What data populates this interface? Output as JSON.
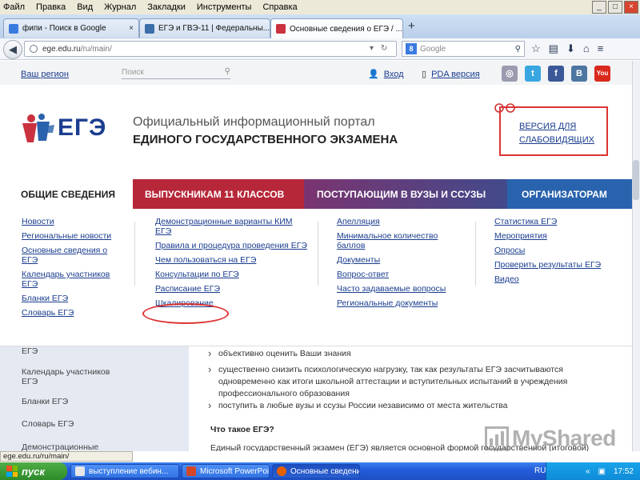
{
  "browser": {
    "menu": [
      "Файл",
      "Правка",
      "Вид",
      "Журнал",
      "Закладки",
      "Инструменты",
      "Справка"
    ],
    "tabs": [
      {
        "label": "фипи - Поиск в Google"
      },
      {
        "label": "ЕГЭ и ГВЭ-11 | Федеральны..."
      },
      {
        "label": "Основные сведения о ЕГЭ / ..."
      }
    ],
    "url_host": "ege.edu.ru",
    "url_path": "/ru/main/",
    "search_placeholder": "Google",
    "status_url": "ege.edu.ru/ru/main/"
  },
  "top": {
    "region": "Ваш регион",
    "search_placeholder": "Поиск",
    "login": "Вход",
    "pda": "PDA версия",
    "social": [
      "ok",
      "twitter",
      "f",
      "B",
      "You"
    ]
  },
  "header": {
    "logo": "ЕГЭ",
    "title_line1": "Официальный информационный портал",
    "title_line2": "ЕДИНОГО ГОСУДАРСТВЕННОГО ЭКЗАМЕНА",
    "vision_line1": "ВЕРСИЯ ДЛЯ",
    "vision_line2": "СЛАБОВИДЯЩИХ"
  },
  "nav": {
    "general": "ОБЩИЕ СВЕДЕНИЯ",
    "graduates": "ВЫПУСКНИКАМ 11 КЛАССОВ",
    "applicants": "ПОСТУПАЮЩИМ В ВУЗЫ И ССУЗЫ",
    "organizers": "ОРГАНИЗАТОРАМ"
  },
  "dropdown": {
    "col1": [
      "Новости",
      "Региональные новости",
      "Основные сведения о ЕГЭ",
      "Календарь участников ЕГЭ",
      "Бланки ЕГЭ",
      "Словарь ЕГЭ"
    ],
    "col2": [
      "Демонстрационные варианты КИМ ЕГЭ",
      "Правила и процедура проведения ЕГЭ",
      "Чем пользоваться на ЕГЭ",
      "Консультации по ЕГЭ",
      "Расписание ЕГЭ",
      "Шкалирование"
    ],
    "col3": [
      "Апелляция",
      "Минимальное количество баллов",
      "Документы",
      "Вопрос-ответ",
      "Часто задаваемые вопросы",
      "Региональные документы"
    ],
    "col4": [
      "Статистика ЕГЭ",
      "Мероприятия",
      "Опросы",
      "Проверить результаты ЕГЭ",
      "Видео"
    ]
  },
  "sidebar": {
    "items": [
      "ЕГЭ",
      "Календарь участников ЕГЭ",
      "Бланки ЕГЭ",
      "Словарь ЕГЭ",
      "Демонстрационные"
    ]
  },
  "content": {
    "bullets": [
      "объективно оценить Ваши знания",
      "существенно снизить психологическую нагрузку, так как результаты ЕГЭ засчитываются одновременно как итоги школьной аттестации и вступительных испытаний в учреждения профессионального образования",
      "поступить в любые вузы и ссузы России независимо от места жительства"
    ],
    "question": "Что такое ЕГЭ?",
    "paragraph": "Единый государственный экзамен (ЕГЭ) является основной формой государственной (итоговой)"
  },
  "watermark": "MyShared",
  "taskbar": {
    "start": "пуск",
    "tasks": [
      "выступление вебин...",
      "Microsoft PowerPoint ...",
      "Основные сведения..."
    ],
    "lang": "RU",
    "time": "17:52"
  },
  "colors": {
    "graduates": "#b62839",
    "organizers": "#2a63ad",
    "link": "#1a3d8f",
    "highlight": "#dd3333"
  }
}
